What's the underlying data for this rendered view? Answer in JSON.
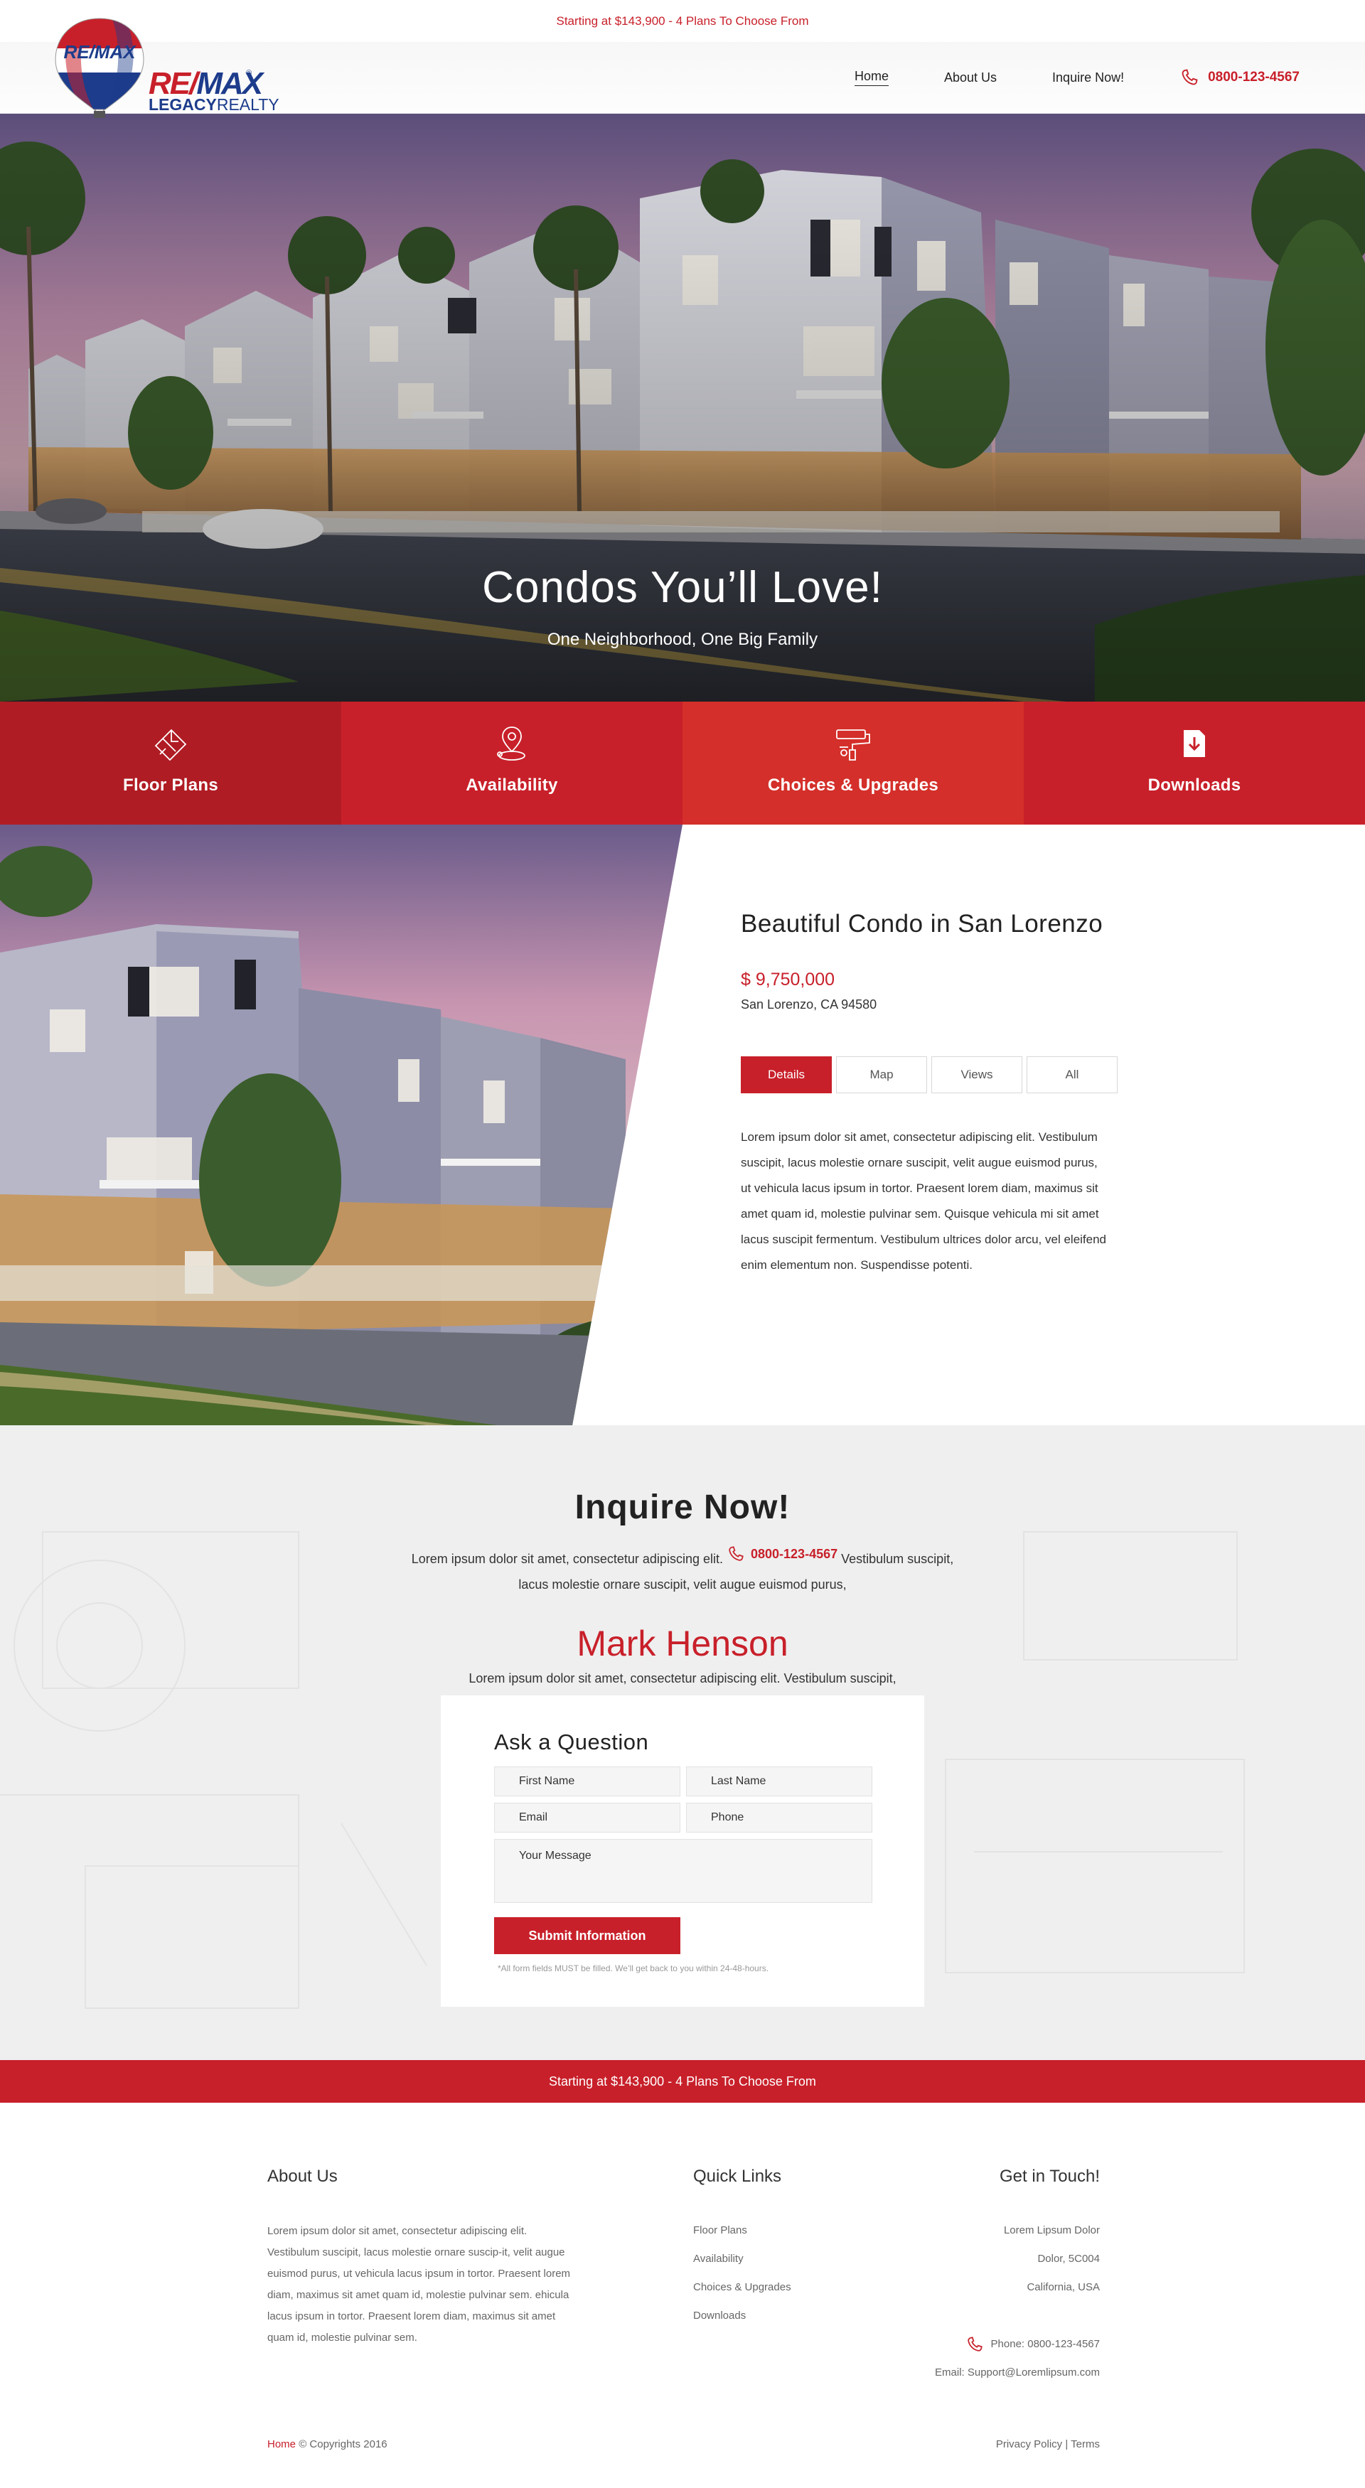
{
  "promo_text": "Starting at $143,900 - 4 Plans To Choose From",
  "brand": {
    "balloon_text": "RE/MAX",
    "name_re": "RE/",
    "name_max": "MAX",
    "registered": "®",
    "sub_bold": "LEGACY",
    "sub_rest": "REALTY"
  },
  "nav": {
    "items": [
      {
        "label": "Home",
        "active": true
      },
      {
        "label": "About Us"
      },
      {
        "label": "Inquire Now!"
      }
    ],
    "phone": "0800-123-4567"
  },
  "hero": {
    "title": "Condos You’ll Love!",
    "subtitle": "One Neighborhood, One Big Family"
  },
  "features": [
    {
      "label": "Floor Plans",
      "icon": "floor-plan-icon",
      "color": "#b01c24"
    },
    {
      "label": "Availability",
      "icon": "location-pin-icon",
      "color": "#c8202a"
    },
    {
      "label": "Choices & Upgrades",
      "icon": "paint-roller-icon",
      "color": "#d42f2a"
    },
    {
      "label": "Downloads",
      "icon": "download-icon",
      "color": "#c8202a"
    }
  ],
  "property": {
    "title": "Beautiful Condo in San Lorenzo",
    "price": "$ 9,750,000",
    "address": "San Lorenzo, CA 94580",
    "tabs": [
      "Details",
      "Map",
      "Views",
      "All"
    ],
    "description": "Lorem ipsum dolor sit amet, consectetur adipiscing elit. Vestibulum suscipit, lacus molestie ornare suscipit, velit augue euismod purus, ut vehicula lacus ipsum in tortor. Praesent lorem diam, maximus sit amet quam id, molestie pulvinar sem. Quisque vehicula mi sit amet lacus suscipit fermentum. Vestibulum ultrices dolor arcu, vel eleifend enim elementum non. Suspendisse potenti."
  },
  "inquire": {
    "title": "Inquire Now!",
    "text_before": "Lorem ipsum dolor sit amet, consectetur adipiscing elit.",
    "phone": "0800-123-4567",
    "text_after": "Vestibulum suscipit, lacus molestie ornare suscipit, velit augue euismod purus,",
    "agent_name": "Mark Henson",
    "agent_text": "Lorem ipsum dolor sit amet, consectetur adipiscing elit. Vestibulum suscipit,"
  },
  "form": {
    "title": "Ask a Question",
    "first_name": "First Name",
    "last_name": "Last Name",
    "email": "Email",
    "phone": "Phone",
    "message": "Your Message",
    "submit": "Submit Information",
    "note": "*All form fields MUST be filled. We’ll get back to you within 24-48-hours."
  },
  "footer": {
    "about_title": "About Us",
    "about_text": "Lorem ipsum dolor sit amet, consectetur adipiscing elit. Vestibulum suscipit, lacus molestie ornare suscip-it, velit augue euismod purus, ut vehicula lacus ipsum in tortor. Praesent lorem diam, maximus sit amet quam id, molestie pulvinar sem. ehicula lacus ipsum in tortor. Praesent lorem diam, maximus sit amet quam id, molestie pulvinar sem.",
    "links_title": "Quick Links",
    "links": [
      "Floor Plans",
      "Availability",
      "Choices & Upgrades",
      "Downloads"
    ],
    "contact_title": "Get in Touch!",
    "address_lines": [
      "Lorem Lipsum Dolor",
      "Dolor, 5C004",
      "California, USA"
    ],
    "phone_label": "Phone: 0800-123-4567",
    "email_label": "Email: Support@Loremlipsum.com",
    "home_link": "Home",
    "copyright": "© Copyrights 2016",
    "privacy": "Privacy Policy",
    "separator": "|",
    "terms": "Terms"
  }
}
